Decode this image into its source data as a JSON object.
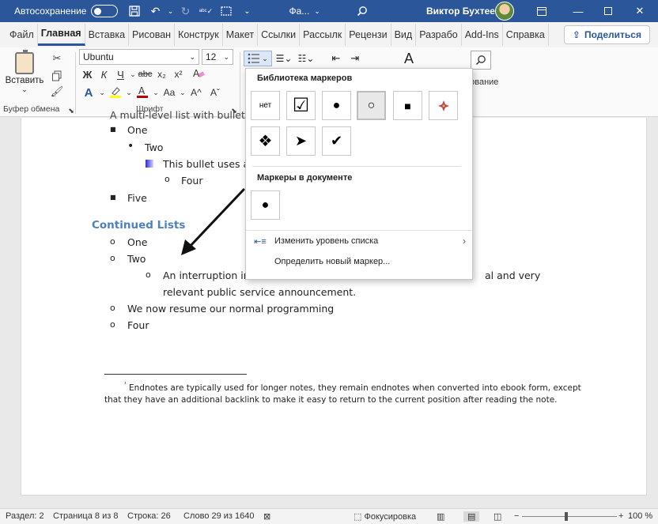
{
  "titlebar": {
    "autosave_label": "Автосохранение",
    "doc_title": "Фа...",
    "user_name": "Виктор Бухтеев",
    "icons": [
      "save-icon",
      "undo-icon",
      "redo-icon",
      "spelling-icon",
      "form-icon",
      "customize-qat-icon",
      "search-icon"
    ]
  },
  "tabs": [
    "Файл",
    "Главная",
    "Вставка",
    "Рисован",
    "Конструк",
    "Макет",
    "Ссылки",
    "Рассылк",
    "Рецензи",
    "Вид",
    "Разрабо",
    "Add-Ins",
    "Справка"
  ],
  "active_tab": "Главная",
  "share_label": "Поделиться",
  "ribbon": {
    "paste_label": "Вставить",
    "clipboard_group": "Буфер обмена",
    "font_name": "Ubuntu",
    "font_size": "12",
    "font_group": "Шрифт",
    "bold": "Ж",
    "italic": "К",
    "underline": "Ч",
    "strike": "abc",
    "subscript": "x₂",
    "superscript": "x²",
    "grow": "A^",
    "shrink": "Aˇ",
    "case": "Aa",
    "styles_label": "рование"
  },
  "document": {
    "cut_line": "A multi-level list with bullets",
    "items": [
      {
        "marker": "■",
        "text": "One"
      },
      {
        "marker": "•",
        "text": "Two"
      },
      {
        "marker": "picture",
        "text": "This bullet uses a"
      },
      {
        "marker": "o",
        "text": "Four"
      },
      {
        "marker": "■",
        "text": "Five"
      }
    ],
    "continued_heading": "Continued Lists",
    "continued": [
      {
        "marker": "o",
        "text": "One"
      },
      {
        "marker": "o",
        "text": "Two"
      },
      {
        "marker": "o",
        "text": "An interruption in",
        "tail": "al and very"
      },
      {
        "marker": "",
        "text": "relevant public service announcement."
      },
      {
        "marker": "o",
        "text": "We now resume our normal programming"
      },
      {
        "marker": "o",
        "text": "Four"
      }
    ],
    "footnote_marker": "¹",
    "footnote_line1": "Endnotes are typically used for longer notes, they remain endnotes when converted into ebook form, except",
    "footnote_line2": "that they have an additional backlink to make it easy to return to the current position after reading the note."
  },
  "bullet_dropdown": {
    "library_title": "Библиотека маркеров",
    "none_label": "нет",
    "library": [
      "☑",
      "●",
      "○",
      "■",
      "✦",
      "❖",
      "➤",
      "✔"
    ],
    "document_title": "Маркеры в документе",
    "document_bullets": [
      "●"
    ],
    "change_level": "Изменить уровень списка",
    "define_new": "Определить новый маркер..."
  },
  "statusbar": {
    "section": "Раздел: 2",
    "page": "Страница 8 из 8",
    "line": "Строка: 26",
    "words": "Слово 29 из 1640",
    "focus": "Фокусировка",
    "zoom": "100 %"
  },
  "colors": {
    "title_bar": "#2b579a",
    "heading": "#4f81bd",
    "font_color": "#c00000",
    "highlight": "#ffff00"
  }
}
